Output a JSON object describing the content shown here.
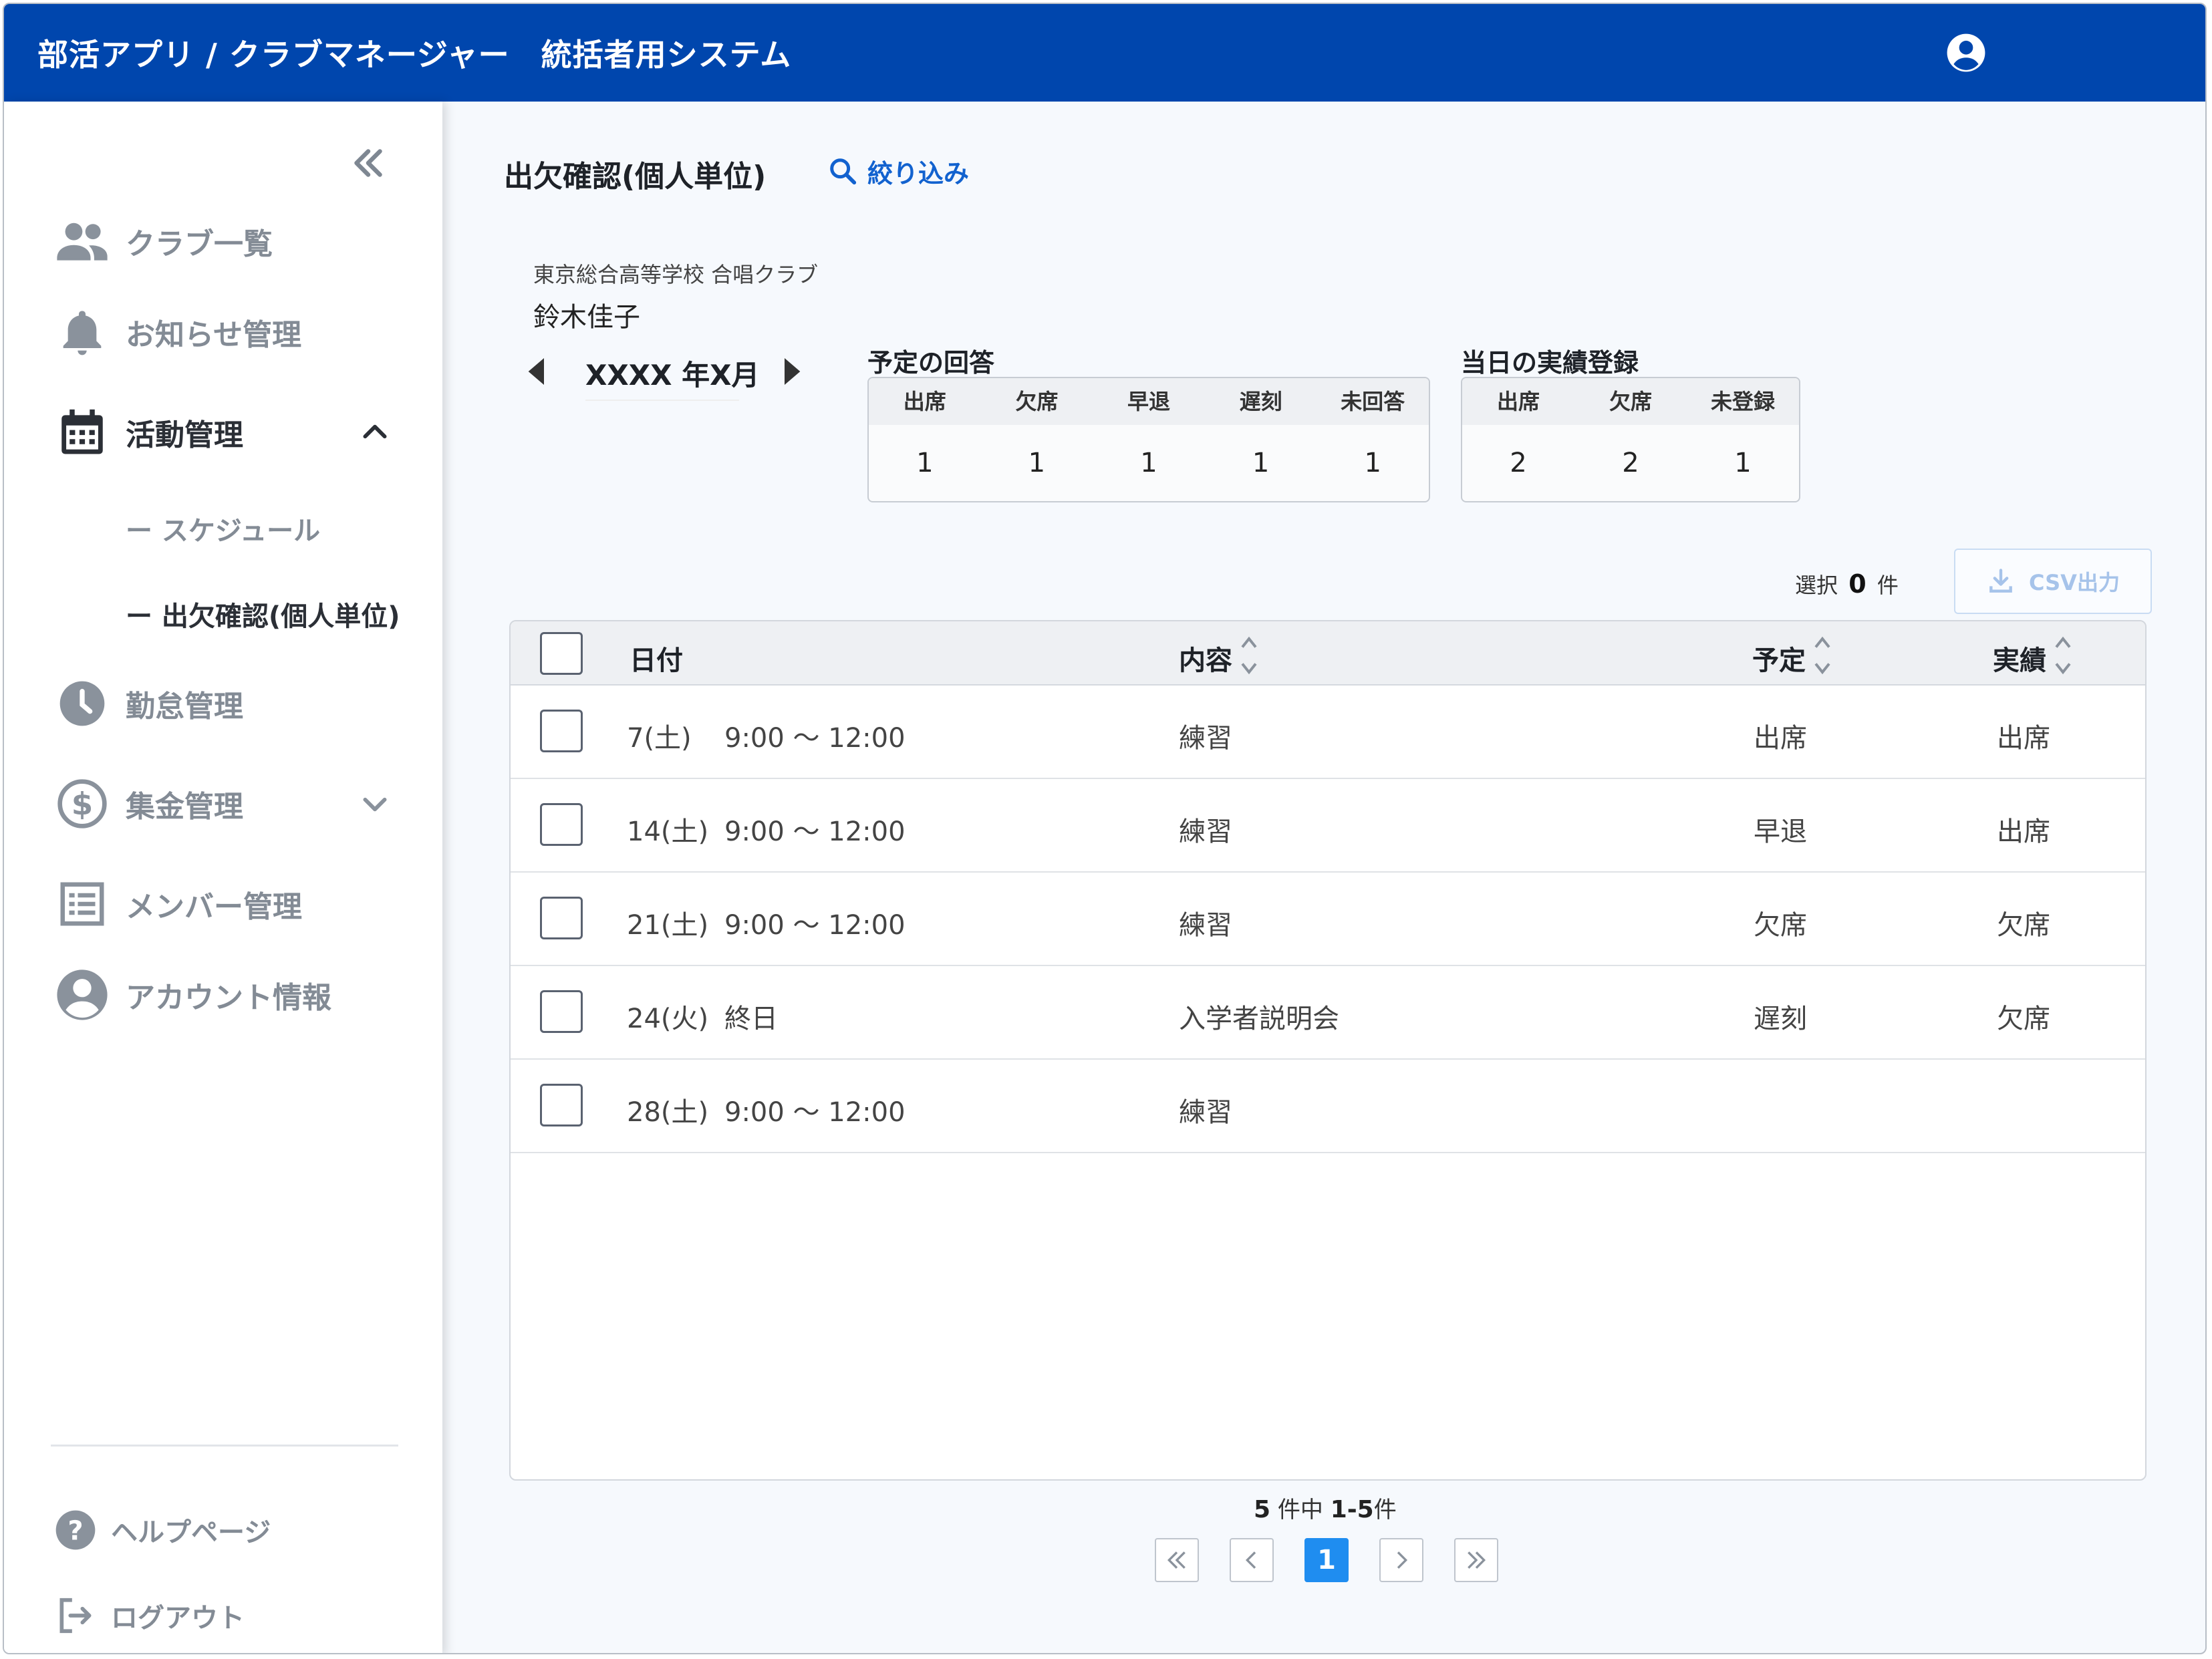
{
  "header": {
    "app_title": "部活アプリ / クラブマネージャー　統括者用システム",
    "user_icon": "account-circle-icon"
  },
  "sidebar": {
    "collapse_icon": "double-chevron-left-icon",
    "items": [
      {
        "label": "クラブ一覧",
        "icon": "people-icon"
      },
      {
        "label": "お知らせ管理",
        "icon": "bell-icon"
      },
      {
        "label": "活動管理",
        "icon": "calendar-icon",
        "expanded": true
      },
      {
        "label": "勤怠管理",
        "icon": "clock-icon"
      },
      {
        "label": "集金管理",
        "icon": "dollar-circle-icon"
      },
      {
        "label": "メンバー管理",
        "icon": "list-icon"
      },
      {
        "label": "アカウント情報",
        "icon": "account-circle-icon"
      }
    ],
    "sub_items": [
      {
        "label": "ー スケジュール"
      },
      {
        "label": "ー 出欠確認(個人単位)",
        "active": true
      }
    ],
    "bottom_items": [
      {
        "label": "ヘルプページ",
        "icon": "help-circle-icon"
      },
      {
        "label": "ログアウト",
        "icon": "logout-icon"
      }
    ]
  },
  "main": {
    "page_title": "出欠確認(個人単位)",
    "filter_label": "絞り込み",
    "club_name": "東京総合高等学校 合唱クラブ",
    "member_name": "鈴木佳子",
    "month_label": "XXXX 年X月",
    "planned": {
      "title": "予定の回答",
      "headers": [
        "出席",
        "欠席",
        "早退",
        "遅刻",
        "未回答"
      ],
      "values": [
        "1",
        "1",
        "1",
        "1",
        "1"
      ]
    },
    "actual": {
      "title": "当日の実績登録",
      "headers": [
        "出席",
        "欠席",
        "未登録"
      ],
      "values": [
        "2",
        "2",
        "1"
      ]
    },
    "selected_prefix": "選択",
    "selected_count": "0",
    "selected_suffix": "件",
    "csv_label": "CSV出力"
  },
  "table": {
    "columns": [
      "日付",
      "内容",
      "予定",
      "実績"
    ],
    "rows": [
      {
        "date": "7(土)",
        "time": "9:00 〜 12:00",
        "content": "練習",
        "plan": "出席",
        "actual": "出席"
      },
      {
        "date": "14(土)",
        "time": "9:00 〜 12:00",
        "content": "練習",
        "plan": "早退",
        "actual": "出席"
      },
      {
        "date": "21(土)",
        "time": "9:00 〜 12:00",
        "content": "練習",
        "plan": "欠席",
        "actual": "欠席"
      },
      {
        "date": "24(火)",
        "time": "終日",
        "content": "入学者説明会",
        "plan": "遅刻",
        "actual": "欠席"
      },
      {
        "date": "28(土)",
        "time": "9:00 〜 12:00",
        "content": "練習",
        "plan": "",
        "actual": ""
      }
    ]
  },
  "pagination": {
    "total": "5",
    "total_suffix": "件中",
    "range": "1-5",
    "range_suffix": "件",
    "current_page": "1"
  }
}
